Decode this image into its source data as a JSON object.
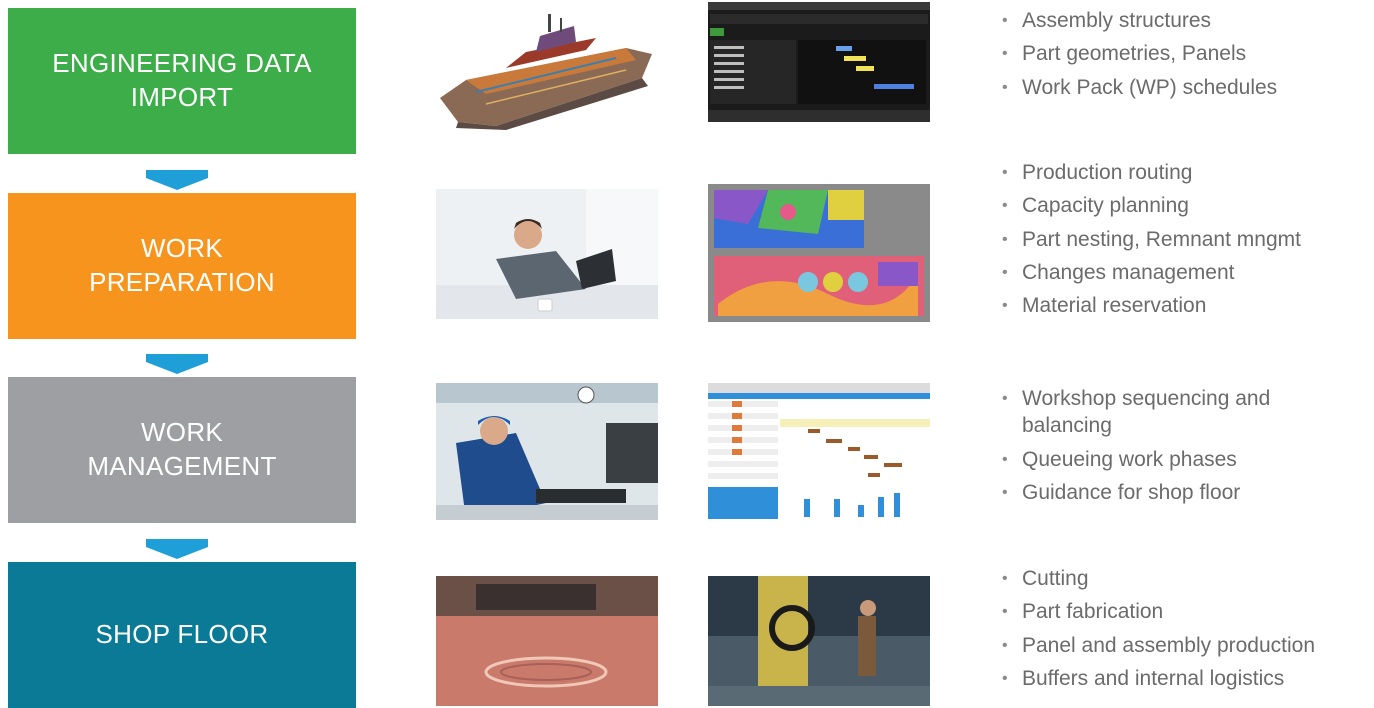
{
  "stages": [
    {
      "lines": [
        "ENGINEERING DATA",
        "IMPORT"
      ],
      "color": "#3cad49"
    },
    {
      "lines": [
        "WORK",
        "PREPARATION"
      ],
      "color": "#f7941d"
    },
    {
      "lines": [
        "WORK",
        "MANAGEMENT"
      ],
      "color": "#9d9fa2"
    },
    {
      "lines": [
        "SHOP FLOOR"
      ],
      "color": "#0b7a96"
    }
  ],
  "arrow_color": "#1f9fd8",
  "bullets": [
    [
      "Assembly structures",
      "Part geometries, Panels",
      "Work Pack (WP) schedules"
    ],
    [
      "Production routing",
      "Capacity planning",
      "Part nesting, Remnant mngmt",
      "Changes management",
      "Material reservation"
    ],
    [
      "Workshop sequencing and balancing",
      "Queueing work phases",
      "Guidance for shop floor"
    ],
    [
      "Cutting",
      "Part fabrication",
      "Panel and assembly production",
      "Buffers and internal logistics"
    ]
  ],
  "images": [
    "ship-3d-model-image",
    "schedule-software-screenshot",
    "man-with-laptop-photo",
    "nesting-software-screenshot",
    "worker-at-computer-photo",
    "gantt-software-screenshot",
    "plate-cutting-photo",
    "welding-machine-photo"
  ]
}
